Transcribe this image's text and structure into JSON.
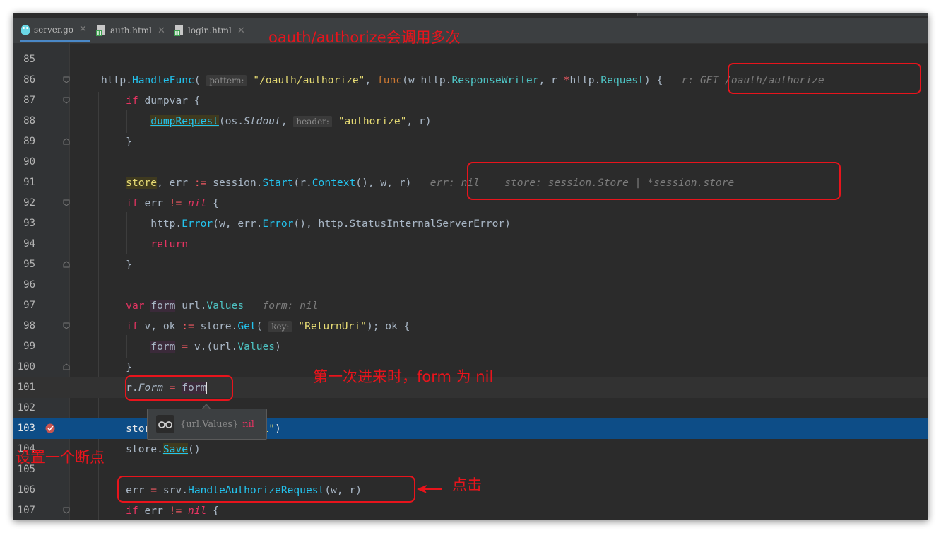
{
  "tabs": [
    {
      "label": "server.go",
      "icon": "go-gopher-icon",
      "active": true
    },
    {
      "label": "auth.html",
      "icon": "html-file-icon",
      "active": false
    },
    {
      "label": "login.html",
      "icon": "html-file-icon",
      "active": false
    }
  ],
  "lines": [
    {
      "n": "85"
    },
    {
      "n": "86"
    },
    {
      "n": "87"
    },
    {
      "n": "88"
    },
    {
      "n": "89"
    },
    {
      "n": "90"
    },
    {
      "n": "91"
    },
    {
      "n": "92"
    },
    {
      "n": "93"
    },
    {
      "n": "94"
    },
    {
      "n": "95"
    },
    {
      "n": "96"
    },
    {
      "n": "97"
    },
    {
      "n": "98"
    },
    {
      "n": "99"
    },
    {
      "n": "100"
    },
    {
      "n": "101"
    },
    {
      "n": "102"
    },
    {
      "n": "103"
    },
    {
      "n": "104"
    },
    {
      "n": "105"
    },
    {
      "n": "106"
    },
    {
      "n": "107"
    }
  ],
  "hints": {
    "pattern": "pattern:",
    "header": "header:",
    "key": "key:"
  },
  "inline_values": {
    "l86": "r: GET /oauth/authorize",
    "l91_err": "err: nil",
    "l91_store": "store: session.Store | *session.store",
    "l97": "form: nil"
  },
  "tooltip": {
    "type": "{url.Values}",
    "value": "nil"
  },
  "annotations": {
    "top": "oauth/authorize会调用多次",
    "first_time": "第一次进来时，form 为 nil",
    "breakpoint": "设置一个断点",
    "click": "点击"
  },
  "colors": {
    "editor_bg": "#2b2b2b",
    "execution_line": "#0d4d87",
    "annotation_red": "#e8141c",
    "keyword": "#cc7832",
    "function": "#23c3ee",
    "string": "#e6db74"
  }
}
